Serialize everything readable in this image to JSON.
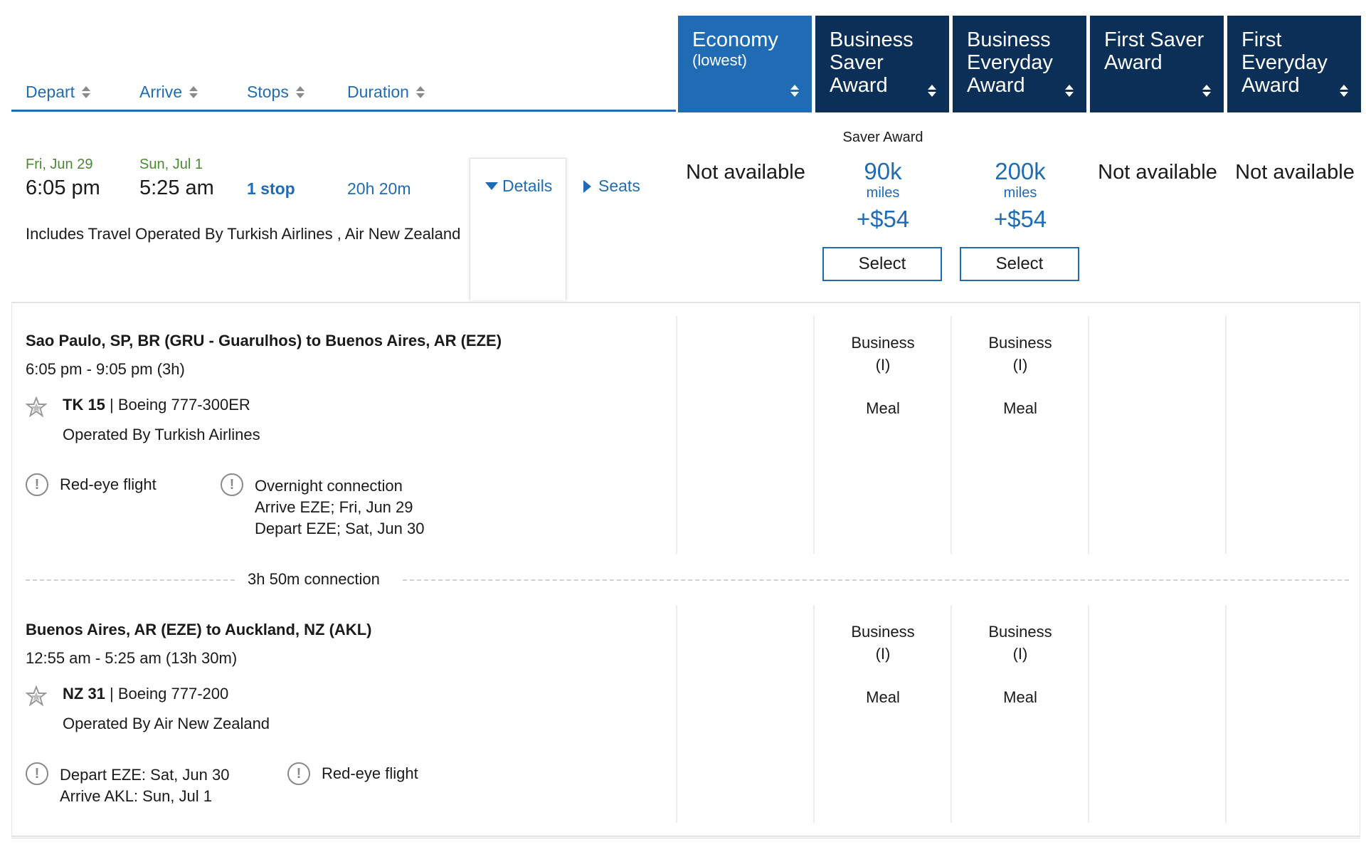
{
  "sort": {
    "depart": "Depart",
    "arrive": "Arrive",
    "stops": "Stops",
    "duration": "Duration"
  },
  "fares": [
    {
      "line1": "Economy",
      "line2": "(lowest)"
    },
    {
      "line1": "Business",
      "line2": "Saver",
      "line3": "Award"
    },
    {
      "line1": "Business",
      "line2": "Everyday",
      "line3": "Award"
    },
    {
      "line1": "First Saver",
      "line2": "Award"
    },
    {
      "line1": "First",
      "line2": "Everyday",
      "line3": "Award"
    }
  ],
  "summary": {
    "depart_date": "Fri, Jun 29",
    "depart_time": "6:05 pm",
    "arrive_date": "Sun, Jul 1",
    "arrive_time": "5:25 am",
    "stops": "1 stop",
    "duration": "20h 20m",
    "details": "Details",
    "seats": "Seats",
    "includes": "Includes Travel Operated By Turkish Airlines , Air New Zealand"
  },
  "prices": {
    "economy": "Not available",
    "saver_award_label": "Saver Award",
    "business_saver": {
      "miles": "90k",
      "unit": "miles",
      "fee": "+$54",
      "select": "Select"
    },
    "business_everyday": {
      "miles": "200k",
      "unit": "miles",
      "fee": "+$54",
      "select": "Select"
    },
    "first_saver": "Not available",
    "first_everyday": "Not available"
  },
  "segments": [
    {
      "route": "Sao Paulo, SP, BR (GRU - Guarulhos) to Buenos Aires, AR (EZE)",
      "times": "6:05 pm - 9:05 pm (3h)",
      "flight": "TK 15",
      "aircraft": "| Boeing 777-300ER",
      "operated": "Operated By Turkish Airlines",
      "alert1": "Red-eye flight",
      "alert2_l1": "Overnight connection",
      "alert2_l2": "Arrive EZE; Fri, Jun 29",
      "alert2_l3": "Depart EZE; Sat, Jun 30",
      "cabin": "Business",
      "cabin_code": "(I)",
      "meal": "Meal"
    },
    {
      "route": "Buenos Aires, AR (EZE) to Auckland, NZ (AKL)",
      "times": "12:55 am - 5:25 am (13h 30m)",
      "flight": "NZ 31",
      "aircraft": "| Boeing 777-200",
      "operated": "Operated By Air New Zealand",
      "alert1_l1": "Depart EZE: Sat, Jun 30",
      "alert1_l2": "Arrive AKL: Sun, Jul 1",
      "alert2": "Red-eye flight",
      "cabin": "Business",
      "cabin_code": "(I)",
      "meal": "Meal"
    }
  ],
  "connection": "3h 50m connection"
}
